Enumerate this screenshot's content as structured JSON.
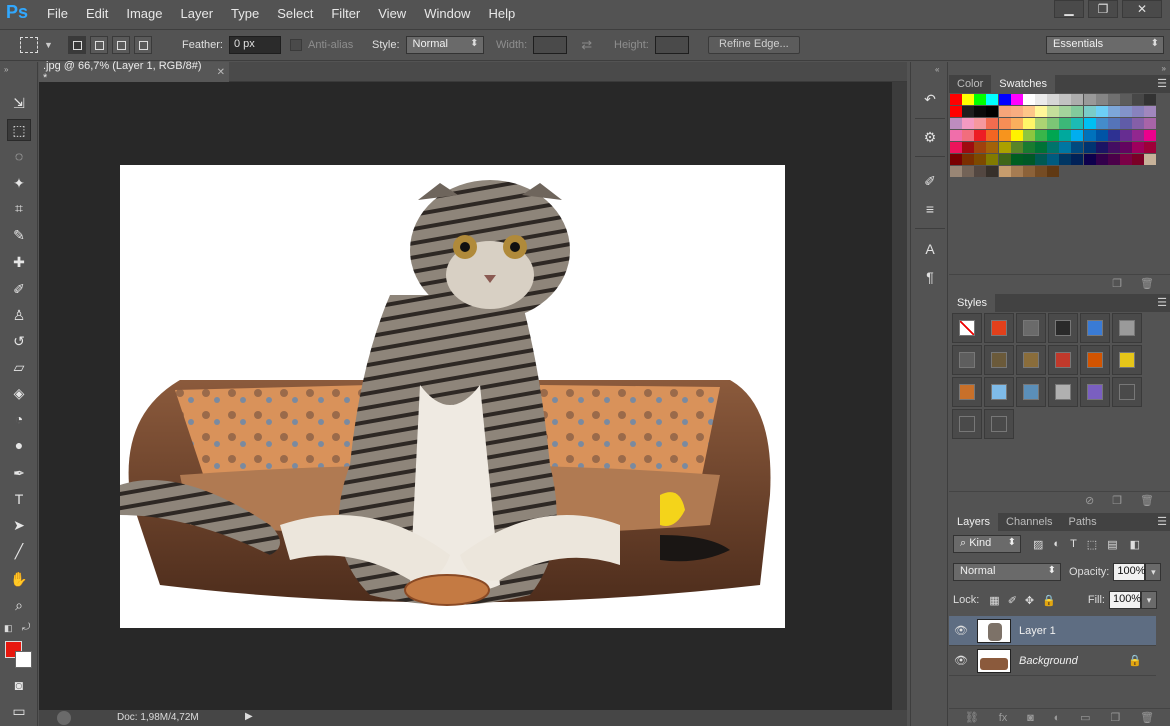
{
  "app": {
    "logo": "Ps"
  },
  "menu": {
    "items": [
      "File",
      "Edit",
      "Image",
      "Layer",
      "Type",
      "Select",
      "Filter",
      "View",
      "Window",
      "Help"
    ]
  },
  "window_controls": {
    "minimize": "▁",
    "restore": "❐",
    "close": "✕"
  },
  "options": {
    "feather_label": "Feather:",
    "feather_value": "0 px",
    "antialias_label": "Anti-alias",
    "style_label": "Style:",
    "style_value": "Normal",
    "width_label": "Width:",
    "height_label": "Height:",
    "refine_edge": "Refine Edge...",
    "workspace": "Essentials"
  },
  "document": {
    "tab_title": ".jpg @ 66,7% (Layer 1, RGB/8#) *",
    "status": "Doc: 1,98M/4,72M"
  },
  "tools": [
    {
      "name": "move-tool-icon",
      "glyph": "⇲"
    },
    {
      "name": "marquee-tool-icon",
      "glyph": "⬚"
    },
    {
      "name": "lasso-tool-icon",
      "glyph": "◌"
    },
    {
      "name": "magic-wand-tool-icon",
      "glyph": "✦"
    },
    {
      "name": "crop-tool-icon",
      "glyph": "⌗"
    },
    {
      "name": "eyedropper-tool-icon",
      "glyph": "✎"
    },
    {
      "name": "healing-brush-tool-icon",
      "glyph": "✚"
    },
    {
      "name": "brush-tool-icon",
      "glyph": "✐"
    },
    {
      "name": "clone-stamp-tool-icon",
      "glyph": "♙"
    },
    {
      "name": "history-brush-tool-icon",
      "glyph": "↺"
    },
    {
      "name": "eraser-tool-icon",
      "glyph": "▱"
    },
    {
      "name": "paint-bucket-tool-icon",
      "glyph": "◈"
    },
    {
      "name": "blur-tool-icon",
      "glyph": "◔"
    },
    {
      "name": "dodge-tool-icon",
      "glyph": "●"
    },
    {
      "name": "pen-tool-icon",
      "glyph": "✒"
    },
    {
      "name": "type-tool-icon",
      "glyph": "T"
    },
    {
      "name": "path-selection-tool-icon",
      "glyph": "➤"
    },
    {
      "name": "line-tool-icon",
      "glyph": "╱"
    },
    {
      "name": "hand-tool-icon",
      "glyph": "✋"
    },
    {
      "name": "zoom-tool-icon",
      "glyph": "⌕"
    }
  ],
  "panels": {
    "color_tab": "Color",
    "swatches_tab": "Swatches",
    "styles_tab": "Styles",
    "layers_tab": "Layers",
    "channels_tab": "Channels",
    "paths_tab": "Paths",
    "kind_filter": "Kind",
    "blend_mode": "Normal",
    "opacity_label": "Opacity:",
    "opacity_value": "100%",
    "lock_label": "Lock:",
    "fill_label": "Fill:",
    "fill_value": "100%"
  },
  "layers": [
    {
      "name": "Layer 1",
      "selected": true,
      "italic": false
    },
    {
      "name": "Background",
      "selected": false,
      "italic": true
    }
  ],
  "colors": {
    "foreground": "#e8180e",
    "background": "#ffffff",
    "accent": "#31a8ff",
    "selection": "#5e6d82"
  },
  "swatches": [
    "#ff0000",
    "#ffff00",
    "#00ff00",
    "#00ffff",
    "#0000ff",
    "#ff00ff",
    "#ffffff",
    "#ebebeb",
    "#d6d6d6",
    "#c2c2c2",
    "#adadad",
    "#999999",
    "#858585",
    "#707070",
    "#5c5c5c",
    "#474747",
    "#333333",
    "#ff0000",
    "#1e1e1e",
    "#0a0a0a",
    "#000000",
    "#f7a57a",
    "#f9ad81",
    "#fdc689",
    "#fff799",
    "#c4df9b",
    "#a3d39c",
    "#82ca9c",
    "#7accc8",
    "#6dcff6",
    "#7da7d9",
    "#8393ca",
    "#8882be",
    "#a187be",
    "#bd8cbf",
    "#f49ac2",
    "#f6989d",
    "#f26c4f",
    "#f68e56",
    "#fbaf5d",
    "#fff568",
    "#acd373",
    "#7cc576",
    "#3cb878",
    "#1cbbb4",
    "#00bff3",
    "#448ccb",
    "#5574b9",
    "#605ca8",
    "#855fa8",
    "#a864a8",
    "#f06eaa",
    "#f26d7d",
    "#ed1c24",
    "#f26522",
    "#f7941d",
    "#fff200",
    "#8dc63f",
    "#39b54a",
    "#00a651",
    "#00a99d",
    "#00aeef",
    "#0072bc",
    "#0054a6",
    "#2e3192",
    "#662d91",
    "#92278f",
    "#ec008c",
    "#ed145b",
    "#9e0b0f",
    "#a0410d",
    "#a36209",
    "#aba000",
    "#598527",
    "#197b30",
    "#007236",
    "#00746b",
    "#0076a3",
    "#004a80",
    "#003471",
    "#1b1464",
    "#440e62",
    "#630460",
    "#9e005d",
    "#9e0039",
    "#790000",
    "#7b2e00",
    "#7d4900",
    "#827b00",
    "#406618",
    "#005e20",
    "#005826",
    "#005952",
    "#005b7f",
    "#003663",
    "#002157",
    "#0d004c",
    "#32004b",
    "#4b0049",
    "#7b0046",
    "#7a0026",
    "#c7b299",
    "#998675",
    "#736357",
    "#534741",
    "#37302a",
    "#c69c6d",
    "#a67c52",
    "#8c6239",
    "#754c24",
    "#603913"
  ],
  "styles": [
    {
      "fill": "#ffffff",
      "name": "style-none"
    },
    {
      "fill": "#e2401b",
      "name": "style-fire"
    },
    {
      "fill": "#6a6a6a",
      "name": "style-frame"
    },
    {
      "fill": "#2a2a2a",
      "name": "style-dark-ring"
    },
    {
      "fill": "#3a7bd5",
      "name": "style-blue-glass"
    },
    {
      "fill": "#9a9a9a",
      "name": "style-gray"
    },
    {
      "fill": "#5e5e5e",
      "name": "style-bevel-gray"
    },
    {
      "fill": "#6b5a3a",
      "name": "style-bronze"
    },
    {
      "fill": "#8a6d3b",
      "name": "style-gold-dark"
    },
    {
      "fill": "#c0392b",
      "name": "style-red-glass"
    },
    {
      "fill": "#d35400",
      "name": "style-rainbow"
    },
    {
      "fill": "#e6c619",
      "name": "style-yellow"
    },
    {
      "fill": "#c8702a",
      "name": "style-orange-bevel"
    },
    {
      "fill": "#7fbbe8",
      "name": "style-sky"
    },
    {
      "fill": "#5b8fb9",
      "name": "style-sunset"
    },
    {
      "fill": "#b0b0b0",
      "name": "style-noise"
    },
    {
      "fill": "#7a5fc0",
      "name": "style-purple"
    },
    {
      "fill": "#4a4a4a",
      "name": "style-empty-1"
    },
    {
      "fill": "#4a4a4a",
      "name": "style-empty-2"
    },
    {
      "fill": "#4a4a4a",
      "name": "style-empty-3"
    }
  ]
}
